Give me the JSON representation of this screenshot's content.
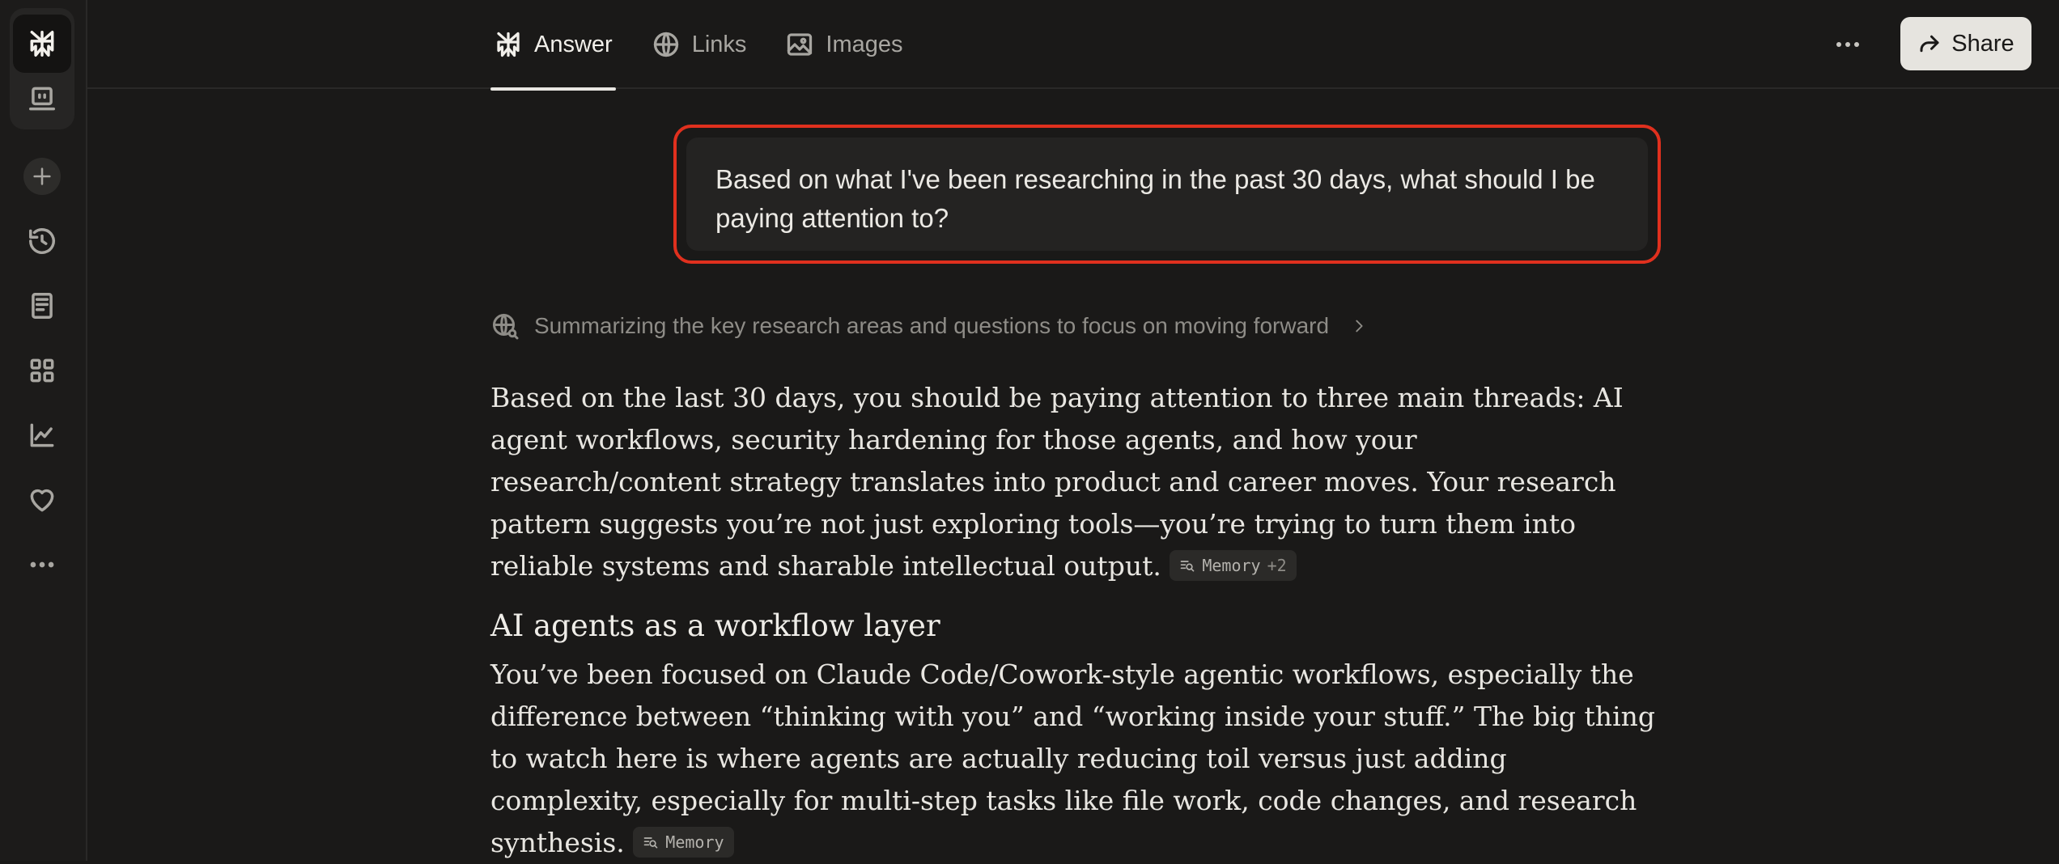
{
  "sidebar": {
    "items": [
      {
        "icon": "perplexity-logo-icon",
        "label": "Home"
      },
      {
        "icon": "computer-icon",
        "label": "Computer"
      },
      {
        "icon": "plus-icon",
        "label": "New thread"
      },
      {
        "icon": "history-icon",
        "label": "History"
      },
      {
        "icon": "document-icon",
        "label": "Library"
      },
      {
        "icon": "grid-icon",
        "label": "Spaces"
      },
      {
        "icon": "chart-icon",
        "label": "Finance"
      },
      {
        "icon": "heart-icon",
        "label": "Health"
      },
      {
        "icon": "more-icon",
        "label": "More"
      }
    ]
  },
  "tabs": [
    {
      "label": "Answer",
      "icon": "perplexity-logo-icon",
      "active": true
    },
    {
      "label": "Links",
      "icon": "globe-icon",
      "active": false
    },
    {
      "label": "Images",
      "icon": "image-icon",
      "active": false
    }
  ],
  "header": {
    "share_label": "Share"
  },
  "query": {
    "text": "Based on what I've been researching in the past 30 days, what should I be paying attention to?",
    "highlight_color": "#e0301e"
  },
  "step": {
    "text": "Summarizing the key research areas and questions to focus on moving forward"
  },
  "answer": {
    "intro": "Based on the last 30 days, you should be paying attention to three main threads: AI agent workflows, security hardening for those agents, and how your research/content strategy translates into product and career moves. Your research pattern suggests you’re not just exploring tools—you’re trying to turn them into reliable systems and sharable intellectual output.",
    "intro_chip": {
      "label": "Memory",
      "extra": "+2"
    },
    "section1_heading": "AI agents as a workflow layer",
    "section1_body": "You’ve been focused on Claude Code/Cowork-style agentic workflows, especially the difference between “thinking with you” and “working inside your stuff.” The big thing to watch here is where agents are actually reducing toil versus just adding complexity, especially for multi-step tasks like file work, code changes, and research synthesis.",
    "section1_chip": {
      "label": "Memory"
    }
  }
}
